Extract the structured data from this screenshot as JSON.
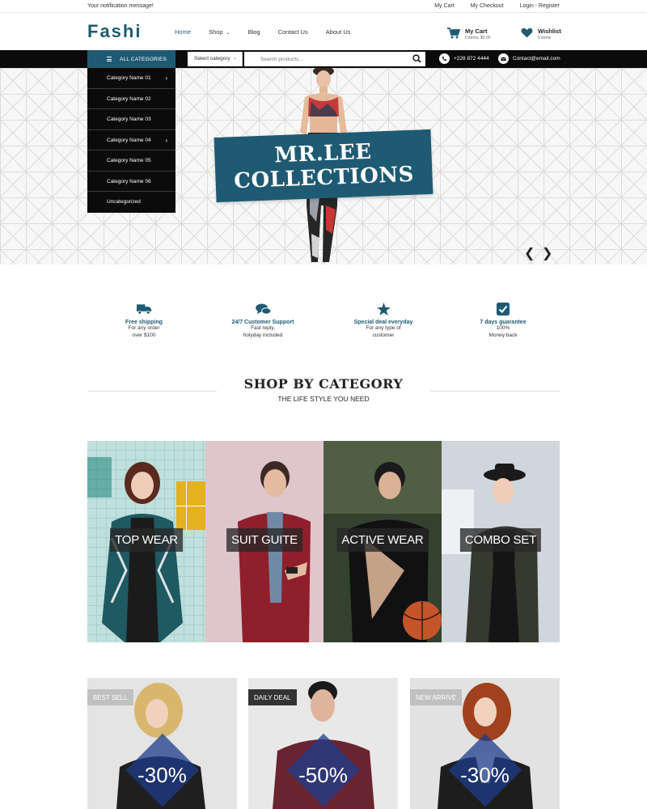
{
  "topbar": {
    "notification": "Your notification message!",
    "links": [
      "My Cart",
      "My Checkout",
      "Login - Register"
    ]
  },
  "header": {
    "logo": "Fashi",
    "nav": [
      {
        "label": "Home",
        "active": true
      },
      {
        "label": "Shop",
        "dropdown": true
      },
      {
        "label": "Blog"
      },
      {
        "label": "Contact Us"
      },
      {
        "label": "About Us"
      }
    ],
    "cart": {
      "title": "My Cart",
      "sub": "0 items, $0.00"
    },
    "wishlist": {
      "title": "Wishlist",
      "sub": "0 items"
    }
  },
  "toolbar": {
    "all_categories": "ALL CATEGORIES",
    "select_category": "Select category",
    "search_placeholder": "Search products...",
    "phone": "+228 872 4444",
    "email": "Contact@email.com"
  },
  "categories_menu": [
    {
      "label": "Category Name 01",
      "has_sub": true
    },
    {
      "label": "Category Name 02",
      "has_sub": false
    },
    {
      "label": "Category Name 03",
      "has_sub": false
    },
    {
      "label": "Category Name 04",
      "has_sub": true
    },
    {
      "label": "Category Name 05",
      "has_sub": false
    },
    {
      "label": "Category Name 06",
      "has_sub": false
    },
    {
      "label": "Uncategorized",
      "has_sub": false
    }
  ],
  "hero": {
    "line1": "MR.LEE",
    "line2": "COLLECTIONS"
  },
  "features": [
    {
      "icon": "truck-icon",
      "title": "Free shipping",
      "desc1": "For any order",
      "desc2": "over $100"
    },
    {
      "icon": "chat-bubbles-icon",
      "title": "24/7 Customer Support",
      "desc1": "Fast reply,",
      "desc2": "holyday included"
    },
    {
      "icon": "star-icon",
      "title": "Special deal everyday",
      "desc1": "For any type of",
      "desc2": "customer"
    },
    {
      "icon": "checkbox-icon",
      "title": "7 days guarantee",
      "desc1": "100%",
      "desc2": "Money back"
    }
  ],
  "section": {
    "title": "SHOP BY CATEGORY",
    "subtitle": "THE LIFE STYLE YOU NEED"
  },
  "tiles": [
    "TOP WEAR",
    "SUIT GUITE",
    "ACTIVE WEAR",
    "COMBO SET"
  ],
  "deals": [
    {
      "badge": "BEST SELL",
      "percent": "-30%"
    },
    {
      "badge": "DAILY DEAL",
      "percent": "-50%"
    },
    {
      "badge": "NEW ARRIVE",
      "percent": "-30%"
    }
  ],
  "colors": {
    "brand": "#1f5a73",
    "dark": "#0b0b0b"
  }
}
